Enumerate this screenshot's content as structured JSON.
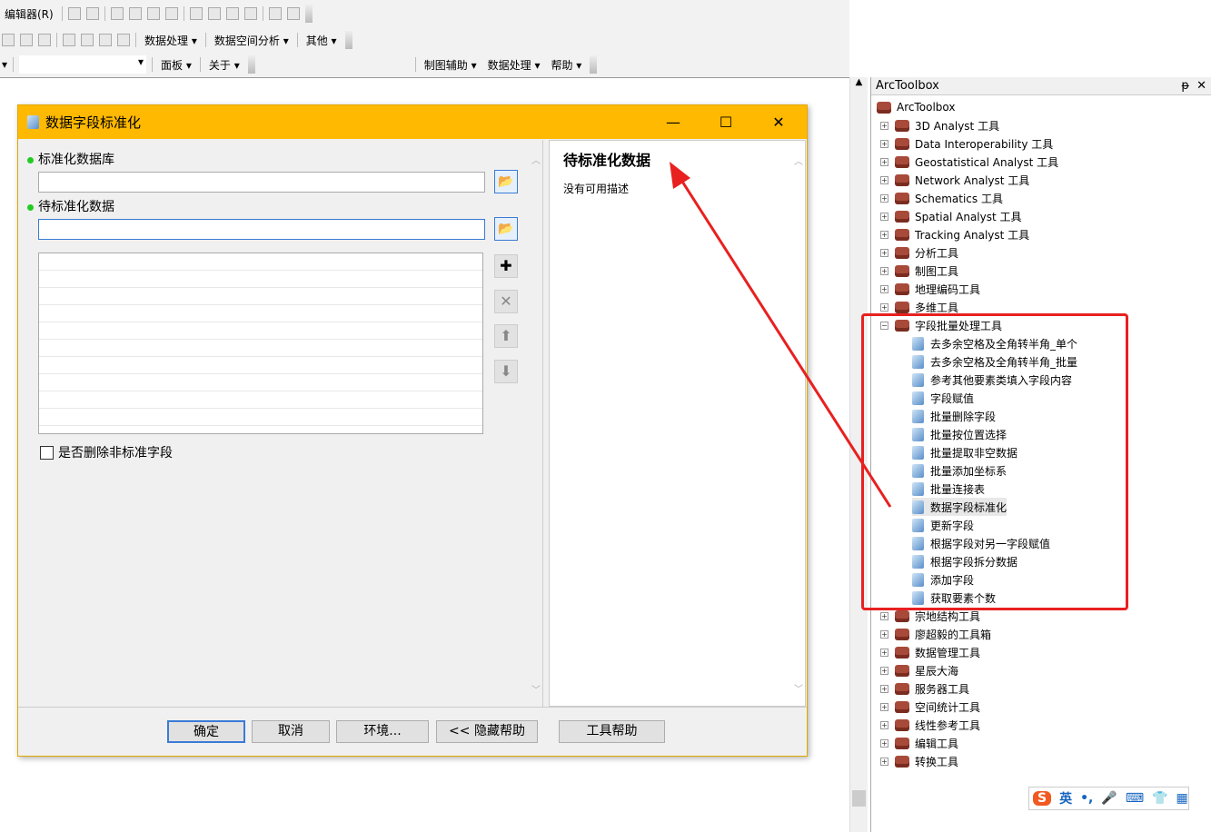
{
  "toolbar": {
    "row1": [
      "编辑器(R)"
    ],
    "row2": [
      "数据处理",
      "数据空间分析",
      "其他"
    ],
    "row3": [
      "面板",
      "关于"
    ],
    "row3_right": [
      "制图辅助",
      "数据处理",
      "帮助"
    ]
  },
  "dialog": {
    "title": "数据字段标准化",
    "minimize": "—",
    "maximize": "☐",
    "close": "✕",
    "param1_label": "标准化数据库",
    "param1_value": "",
    "param2_label": "待标准化数据",
    "param2_value": "",
    "checkbox_label": "是否删除非标准字段",
    "checkbox_checked": false,
    "help_title": "待标准化数据",
    "help_text": "没有可用描述",
    "buttons": {
      "ok": "确定",
      "cancel": "取消",
      "env": "环境...",
      "hide_help": "<< 隐藏帮助",
      "tool_help": "工具帮助"
    }
  },
  "arctoolbox": {
    "title": "ArcToolbox",
    "pin": "ᵽ",
    "close": "✕",
    "root": "ArcToolbox",
    "toolboxes_before": [
      "3D Analyst 工具",
      "Data Interoperability 工具",
      "Geostatistical Analyst 工具",
      "Network Analyst 工具",
      "Schematics 工具",
      "Spatial Analyst 工具",
      "Tracking Analyst 工具",
      "分析工具",
      "制图工具",
      "地理编码工具",
      "多维工具"
    ],
    "expanded": "字段批量处理工具",
    "tools": [
      "去多余空格及全角转半角_单个",
      "去多余空格及全角转半角_批量",
      "参考其他要素类填入字段内容",
      "字段赋值",
      "批量删除字段",
      "批量按位置选择",
      "批量提取非空数据",
      "批量添加坐标系",
      "批量连接表",
      "数据字段标准化",
      "更新字段",
      "根据字段对另一字段赋值",
      "根据字段拆分数据",
      "添加字段",
      "获取要素个数"
    ],
    "selected_tool": "数据字段标准化",
    "toolboxes_after": [
      "宗地结构工具",
      "廖超毅的工具箱",
      "数据管理工具",
      "星辰大海",
      "服务器工具",
      "空间统计工具",
      "线性参考工具",
      "编辑工具",
      "转换工具"
    ]
  },
  "ime": {
    "lang": "英",
    "punct": "•,"
  },
  "annotation_color": "#e82020"
}
